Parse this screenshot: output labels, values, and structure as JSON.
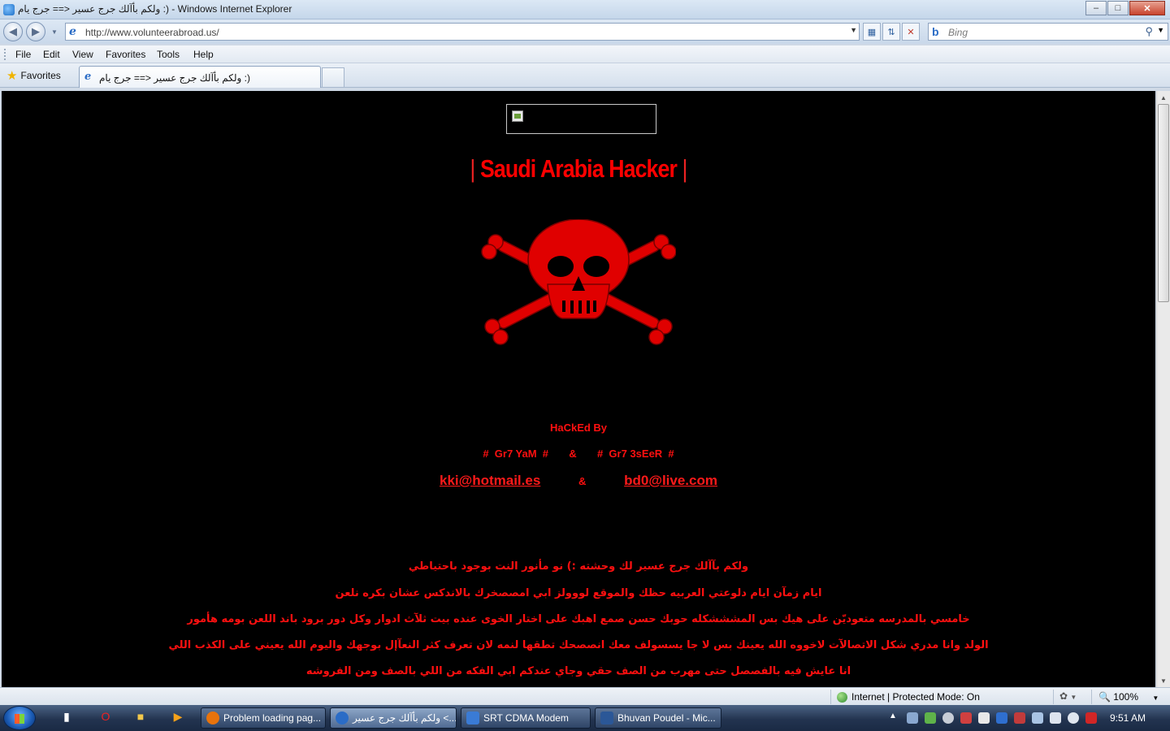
{
  "window": {
    "title": "ولكم بأآلك جرج عسير <== جرج يام :) - Windows Internet Explorer",
    "minimize": "–",
    "maximize": "□",
    "close": "✕"
  },
  "navigation": {
    "back_icon": "back-arrow-icon",
    "forward_icon": "forward-arrow-icon",
    "address": "http://www.volunteerabroad.us/",
    "search_placeholder": "Bing"
  },
  "menu": {
    "items": [
      "File",
      "Edit",
      "View",
      "Favorites",
      "Tools",
      "Help"
    ]
  },
  "tabs": {
    "favorites_label": "Favorites",
    "active_tab": "ولكم بأآلك جرج عسير <== جرج يام :)"
  },
  "page": {
    "banner_bar_left": "|",
    "banner_title": "Saudi Arabia Hacker",
    "banner_bar_right": "|",
    "hacked_by": "HaCkEd By",
    "names_line": "#  Gr7 YaM  #       &       #  Gr7 3sEeR  #",
    "email_1": "kki@hotmail.es",
    "email_amp": "&",
    "email_2": "bd0@live.com",
    "arabic_lines": [
      "ولكم بآآلك جرج عسير لك وحشته :) نو مأنور النت بوجود باحتياطي",
      "ايام زمآن ايام دلوعتي العربيه حظك والموقع لووولز ابي امصصخرك بالاندكس عشان بكره نلعن",
      "خامسي بالمدرسه متعوديّن على هيك بس المشششكله حوبك حسن صمع اهبك على اختار الخوى عنده بيت ثلآث ادوار وكل دور برود باند اللعن بومه هأمور",
      "الولد وانا مدري شكل الاتصالآت لاخووه الله يعينك بس لا جا يسسولف معك انصصحك تطقها لنمه لان تعرف كثر النعآإل بوجهك واليوم الله يعيني على الكذب اللي",
      "انا عايش فيه بالفصصل حتى مهرب من الصف حقي وجاي عندكم ابي الفكه من اللي بالصف ومن الفروشه"
    ],
    "accent_color": "#ff0000",
    "background_color": "#000000"
  },
  "status": {
    "zone": "Internet | Protected Mode: On",
    "zoom": "100%"
  },
  "taskbar": {
    "tasks": [
      {
        "label": "Problem loading pag...",
        "icon_color": "#e8730c"
      },
      {
        "label": "ولكم بأآلك جرج عسير <...",
        "icon_color": "#2a6cc6"
      },
      {
        "label": "SRT CDMA Modem",
        "icon_color": "#3a7bd5"
      },
      {
        "label": "Bhuvan Poudel - Mic...",
        "icon_color": "#2b5797"
      }
    ],
    "clock": "9:51 AM"
  }
}
